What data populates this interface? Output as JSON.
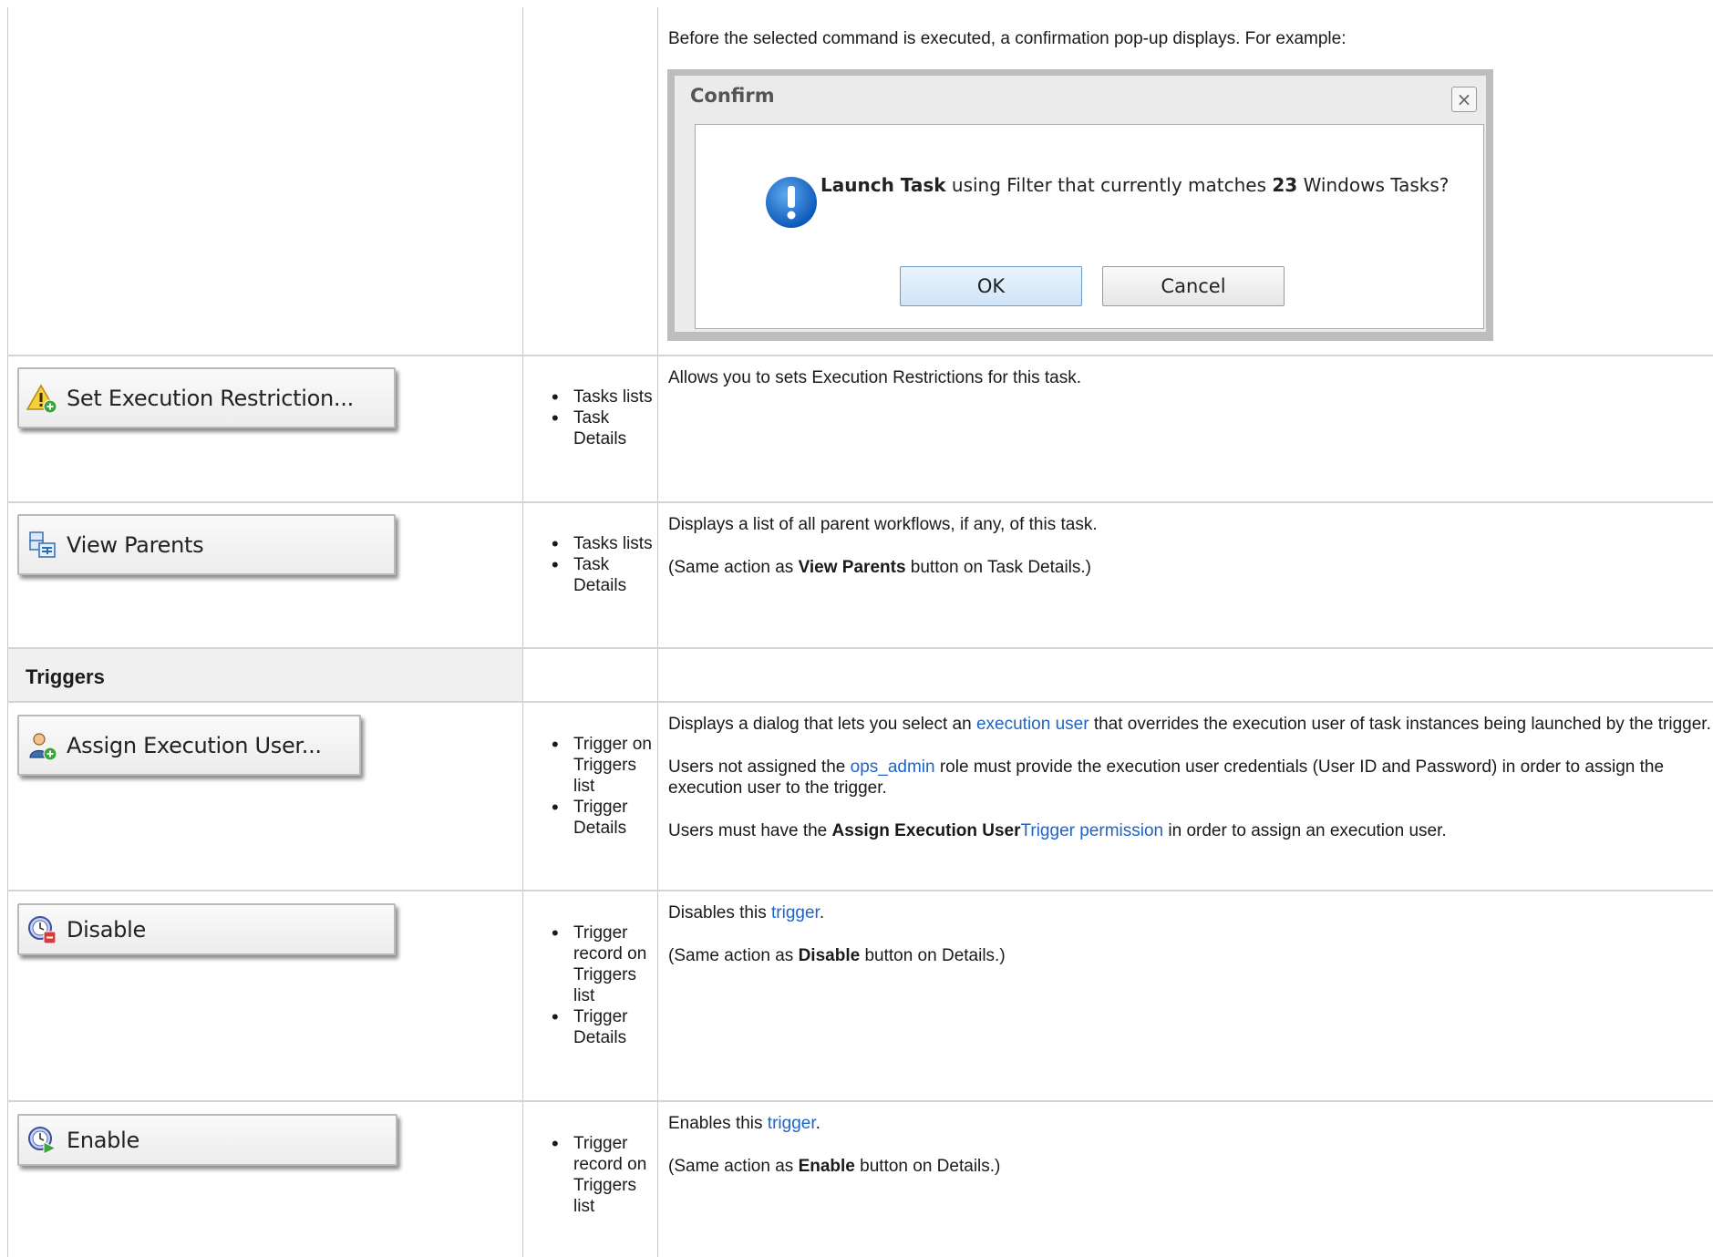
{
  "intro": {
    "text": "Before the selected command is executed, a confirmation pop-up displays. For example:"
  },
  "dialog": {
    "title": "Confirm",
    "close_glyph": "×",
    "message_bold1": "Launch Task",
    "message_mid": " using Filter that currently matches ",
    "message_bold2": "23",
    "message_end": " Windows Tasks?",
    "ok_label": "OK",
    "cancel_label": "Cancel",
    "icon": "info-exclamation-icon"
  },
  "rows": {
    "set_exec": {
      "button_label": "Set Execution Restriction...",
      "icon": "warning-add-icon",
      "bullet1": "Tasks lists",
      "bullet2": "Task Details",
      "desc": "Allows you to sets Execution Restrictions for this task."
    },
    "view_parents": {
      "button_label": "View Parents",
      "icon": "parents-icon",
      "bullet1": "Tasks lists",
      "bullet2": "Task Details",
      "desc1": "Displays a list of all parent workflows, if any, of this task.",
      "desc2_pre": "(Same action as ",
      "desc2_bold": "View Parents",
      "desc2_post": " button on Task Details.)"
    },
    "triggers_section": {
      "title": "Triggers"
    },
    "assign_user": {
      "button_label": "Assign Execution User...",
      "icon": "user-add-icon",
      "bullet1": "Trigger on Triggers list",
      "bullet2": "Trigger Details",
      "p1_pre": "Displays a dialog that lets you select an ",
      "p1_link": "execution user",
      "p1_post": " that overrides the execution user of task instances being launched by the trigger.",
      "p2_pre": "Users not assigned the ",
      "p2_link": "ops_admin",
      "p2_post": " role must provide the execution user credentials (User ID and Password) in order to assign the execution user to the trigger.",
      "p3_pre": "Users must have the ",
      "p3_bold": "Assign Execution User",
      "p3_link": "Trigger permission",
      "p3_post": " in order to assign an execution user."
    },
    "disable": {
      "button_label": "Disable",
      "icon": "clock-disable-icon",
      "bullet1": "Trigger record on Triggers list",
      "bullet2": "Trigger Details",
      "p1_pre": "Disables this ",
      "p1_link": "trigger",
      "p1_post": ".",
      "p2_pre": "(Same action as ",
      "p2_bold": "Disable",
      "p2_post": " button on Details.)"
    },
    "enable": {
      "button_label": "Enable",
      "icon": "clock-enable-icon",
      "bullet1": "Trigger record on Triggers list",
      "p1_pre": " Enables this ",
      "p1_link": "trigger",
      "p1_post": ".",
      "p2_pre": "(Same action as ",
      "p2_bold": "Enable",
      "p2_post": " button on Details.)"
    }
  },
  "colors": {
    "link": "#1f63c8",
    "grid": "#d4d4d4",
    "section_bg": "#f0f0f0"
  }
}
